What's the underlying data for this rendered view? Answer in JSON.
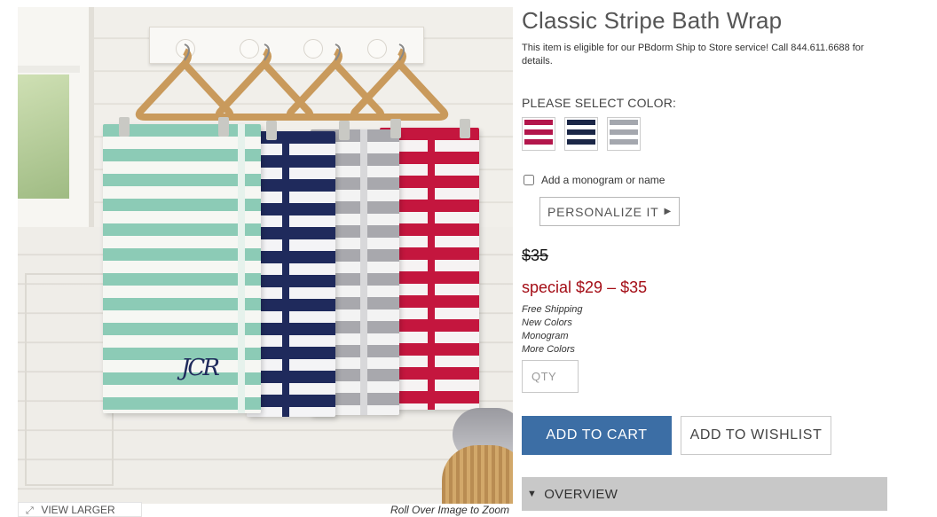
{
  "product": {
    "title": "Classic Stripe Bath Wrap",
    "ship_note": "This item is eligible for our PBdorm Ship to Store service! Call 844.611.6688 for details.",
    "color_label": "PLEASE SELECT COLOR:",
    "colors": [
      {
        "name": "red-stripe",
        "hex": "#b3164b"
      },
      {
        "name": "navy-stripe",
        "hex": "#1b2747"
      },
      {
        "name": "grey-stripe",
        "hex": "#a4a7ae"
      }
    ],
    "monogram_label": "Add a monogram or name",
    "personalize_label": "PERSONALIZE IT",
    "old_price": "$35",
    "special_price": "special $29 – $35",
    "features": [
      "Free Shipping",
      "New Colors",
      "Monogram",
      "More Colors"
    ],
    "qty_placeholder": "QTY",
    "add_to_cart_label": "ADD TO CART",
    "add_to_wishlist_label": "ADD TO WISHLIST",
    "overview_label": "OVERVIEW"
  },
  "image": {
    "view_larger_label": "VIEW LARGER",
    "zoom_hint": "Roll Over Image to Zoom",
    "monogram_text": "JCR"
  },
  "theme": {
    "accent": "#3c6ea5",
    "price_red": "#a40d16",
    "overview_bg": "#c8c8c8"
  },
  "icons": {
    "personalize": "caret-right-icon",
    "overview": "caret-down-icon",
    "view_larger": "expand-icon"
  }
}
